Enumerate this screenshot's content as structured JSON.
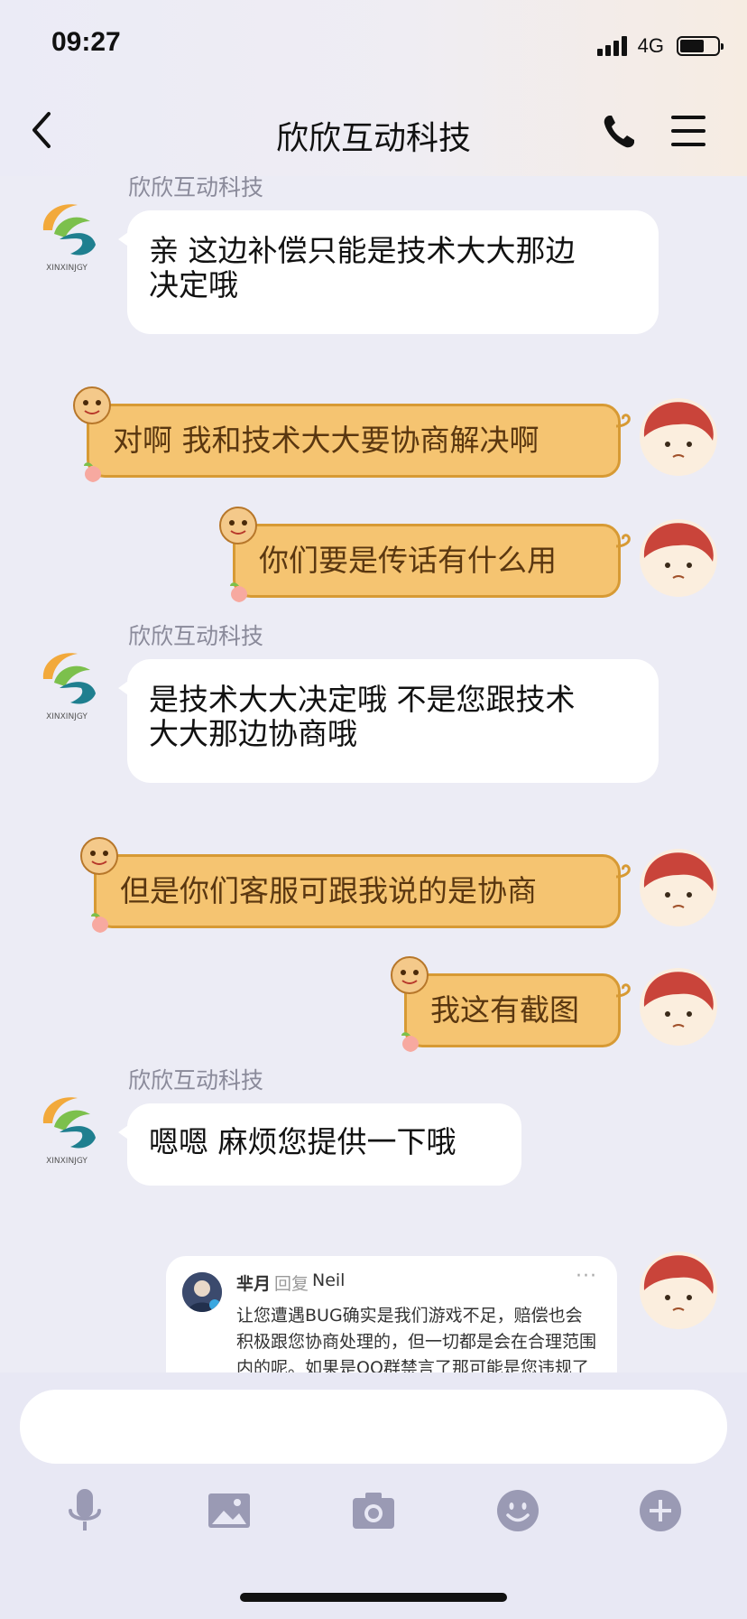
{
  "status": {
    "time": "09:27",
    "network": "4G"
  },
  "header": {
    "title": "欣欣互动科技"
  },
  "shop": {
    "name": "欣欣互动科技",
    "logo_text": "XINXINJGY"
  },
  "messages": [
    {
      "side": "left",
      "sender": "欣欣互动科技",
      "lines": [
        "亲 这边补偿只能是技术大大那边",
        "决定哦"
      ]
    },
    {
      "side": "right",
      "text": "对啊 我和技术大大要协商解决啊"
    },
    {
      "side": "right",
      "text": "你们要是传话有什么用"
    },
    {
      "side": "left",
      "sender": "欣欣互动科技",
      "lines": [
        "是技术大大决定哦 不是您跟技术",
        "大大那边协商哦"
      ]
    },
    {
      "side": "right",
      "text": "但是你们客服可跟我说的是协商"
    },
    {
      "side": "right",
      "text": "我这有截图"
    },
    {
      "side": "left",
      "sender": "欣欣互动科技",
      "lines": [
        "嗯嗯 麻烦您提供一下哦"
      ]
    }
  ],
  "quote": {
    "author": "芈月",
    "reply_label": "回复",
    "reply_to": "Neil",
    "more": "···",
    "lines": [
      "让您遭遇BUG确实是我们游戏不足，赔偿也会",
      "积极跟您协商处理的，但一切都是会在合理范围",
      "内的呢。如果是QQ群禁言了那可能是您违规了"
    ]
  },
  "input": {
    "value": ""
  },
  "toolbar": [
    "mic-icon",
    "image-icon",
    "camera-icon",
    "emoji-icon",
    "plus-icon"
  ],
  "colors": {
    "accent_orange": "#f5c471",
    "bubble_border": "#d79a34",
    "chat_bg": "#ececf5"
  }
}
